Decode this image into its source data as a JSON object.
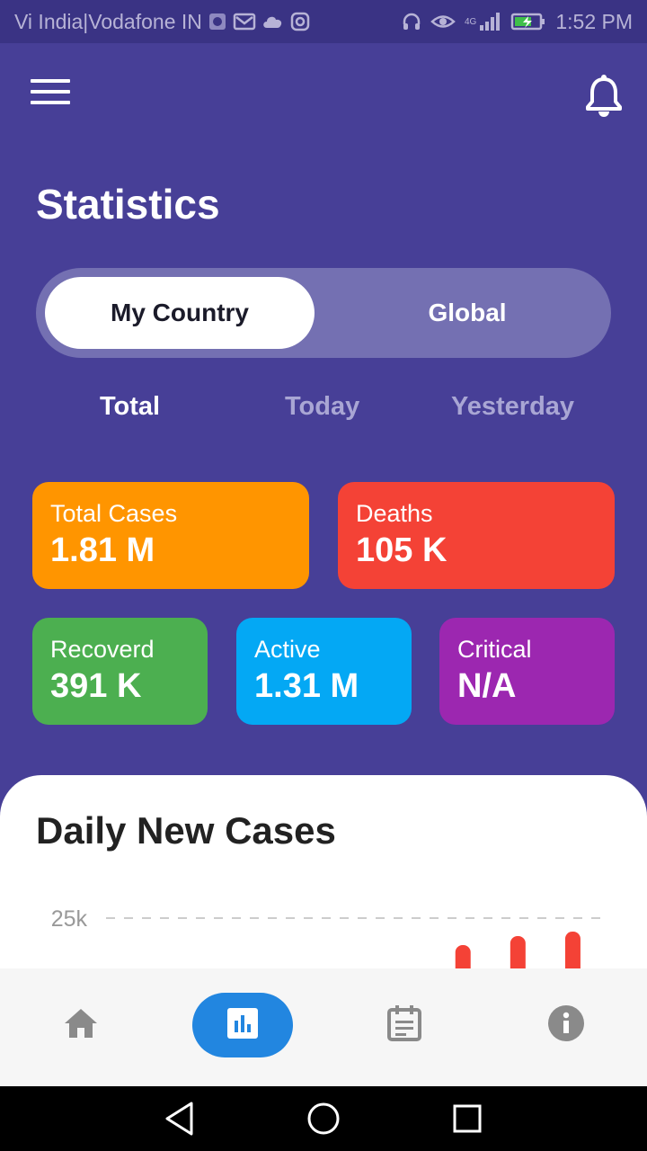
{
  "status_bar": {
    "carrier": "Vi India|Vodafone IN",
    "network": "4G",
    "time": "1:52 PM"
  },
  "header": {
    "menu_icon": "hamburger-menu-icon",
    "notification_icon": "bell-icon"
  },
  "page_title": "Statistics",
  "scope_toggle": {
    "options": [
      "My Country",
      "Global"
    ],
    "selected": "My Country"
  },
  "time_tabs": {
    "items": [
      "Total",
      "Today",
      "Yesterday"
    ],
    "selected": "Total"
  },
  "stats": [
    {
      "label": "Total Cases",
      "value": "1.81 M",
      "color": "#ff9500"
    },
    {
      "label": "Deaths",
      "value": "105 K",
      "color": "#f44236"
    },
    {
      "label": "Recoverd",
      "value": "391 K",
      "color": "#4caf50"
    },
    {
      "label": "Active",
      "value": "1.31 M",
      "color": "#04a8f4"
    },
    {
      "label": "Critical",
      "value": "N/A",
      "color": "#9c27b0"
    }
  ],
  "chart_section": {
    "title": "Daily New Cases"
  },
  "chart_data": {
    "type": "bar",
    "title": "Daily New Cases",
    "yticks": [
      "25k"
    ],
    "values": [
      null,
      null,
      null,
      null,
      null,
      null,
      22000,
      23000,
      23500
    ],
    "bar_color": "#f44236",
    "grid": "dashed horizontal"
  },
  "bottom_nav": {
    "items": [
      {
        "icon": "home-icon"
      },
      {
        "icon": "bar-chart-icon",
        "active": true
      },
      {
        "icon": "calendar-icon"
      },
      {
        "icon": "info-icon"
      }
    ],
    "active_color": "#2286e0"
  },
  "system_nav": {
    "items": [
      "back-icon",
      "home-circle-icon",
      "recents-icon"
    ]
  }
}
